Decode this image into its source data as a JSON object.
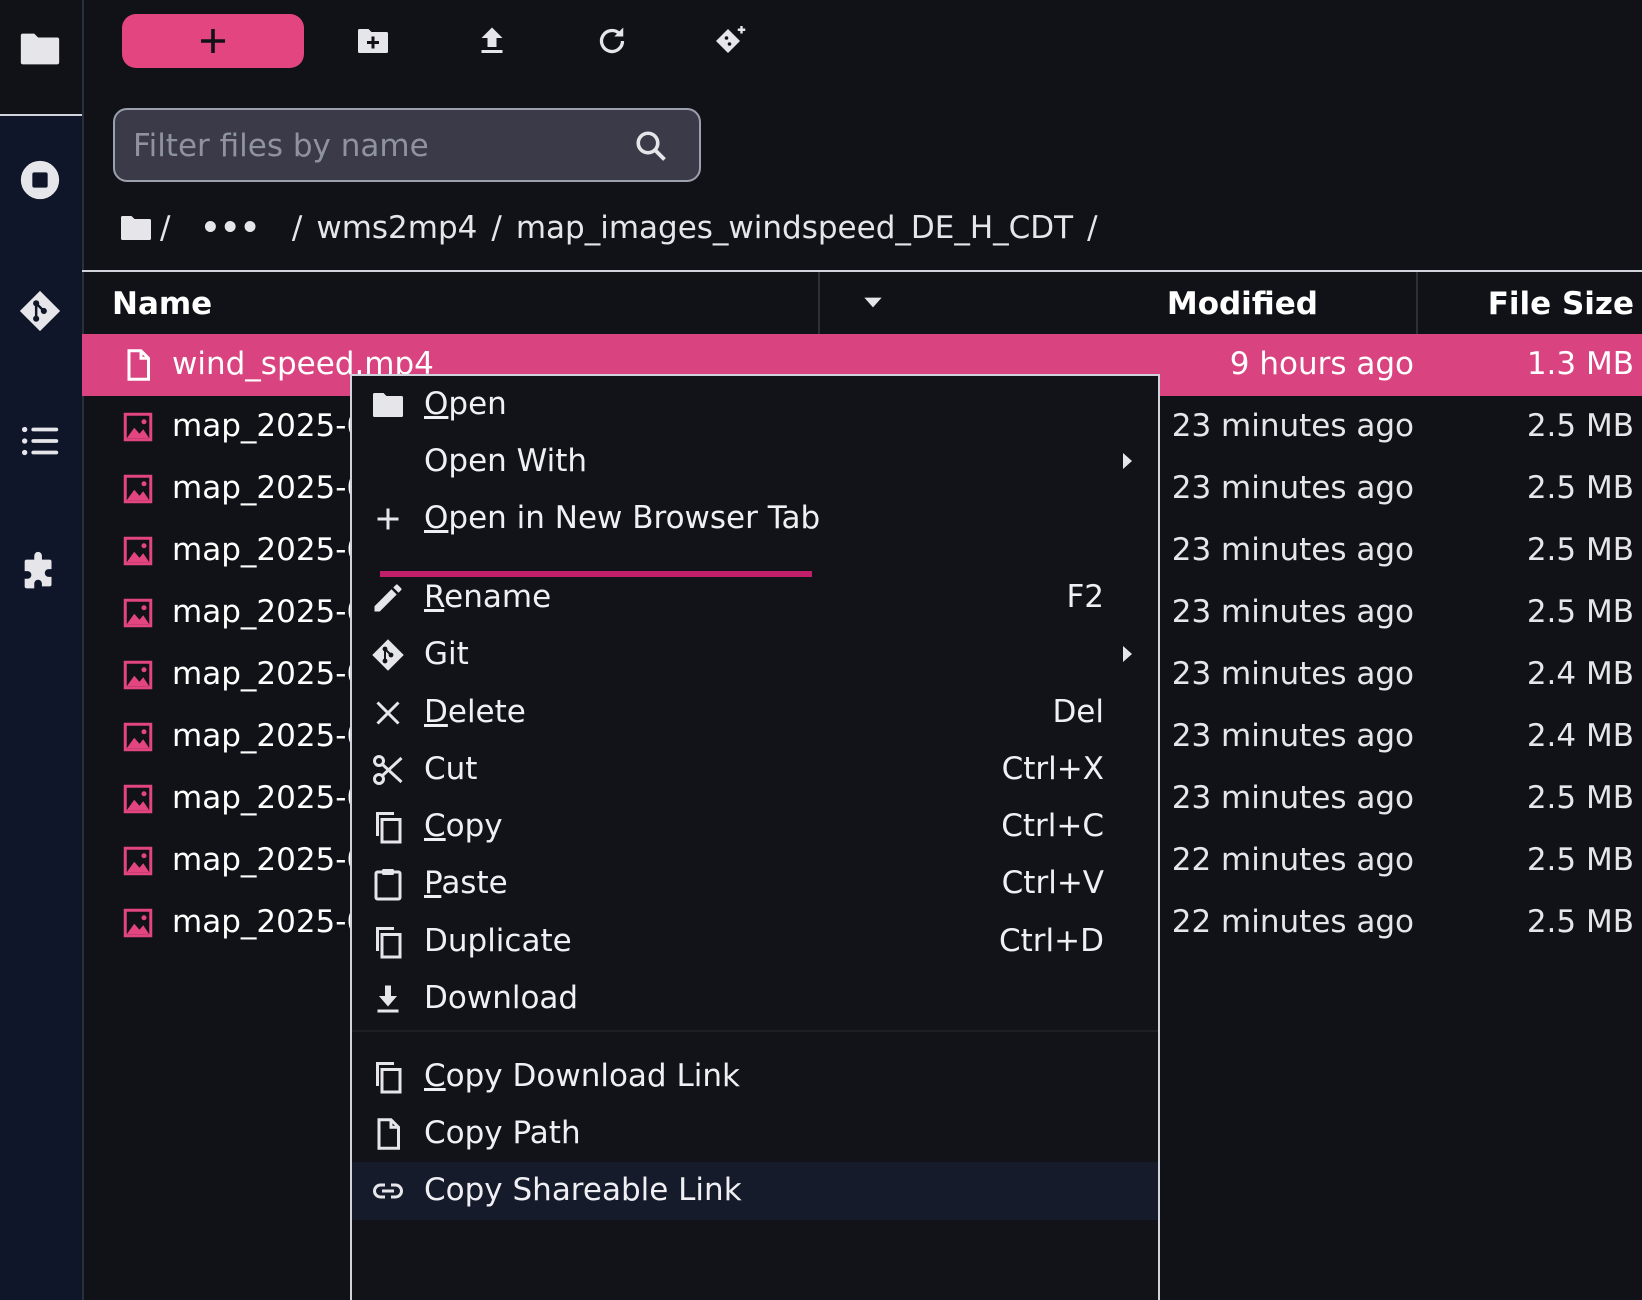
{
  "colors": {
    "accent": "#e2457f",
    "selected_row": "#d9437f",
    "background": "#111217",
    "sidebar": "#0f1629",
    "menu_accent": "#c21f6a"
  },
  "activity_bar": {
    "items": [
      {
        "name": "file-browser",
        "icon": "folder-icon"
      },
      {
        "name": "running-sessions",
        "icon": "stop-circle-icon"
      },
      {
        "name": "git",
        "icon": "git-icon"
      },
      {
        "name": "table-of-contents",
        "icon": "list-icon"
      },
      {
        "name": "extensions",
        "icon": "puzzle-icon"
      }
    ]
  },
  "toolbar": {
    "new_launcher_icon": "plus-icon",
    "new_folder_icon": "new-folder-icon",
    "upload_icon": "upload-icon",
    "refresh_icon": "refresh-icon",
    "git_clone_icon": "git-clone-icon"
  },
  "filter": {
    "placeholder": "Filter files by name",
    "value": ""
  },
  "breadcrumb": {
    "root": "/",
    "ellipsis": "•••",
    "sep": "/",
    "parts": [
      "wms2mp4",
      "map_images_windspeed_DE_H_CDT"
    ],
    "trailing": "/"
  },
  "columns": {
    "name": "Name",
    "modified": "Modified",
    "size": "File Size"
  },
  "files": [
    {
      "name": "wind_speed.mp4",
      "modified": "9 hours ago",
      "size": "1.3 MB",
      "type": "file",
      "selected": true
    },
    {
      "name": "map_2025-0",
      "modified": "23 minutes ago",
      "size": "2.5 MB",
      "type": "image"
    },
    {
      "name": "map_2025-0",
      "modified": "23 minutes ago",
      "size": "2.5 MB",
      "type": "image"
    },
    {
      "name": "map_2025-0",
      "modified": "23 minutes ago",
      "size": "2.5 MB",
      "type": "image"
    },
    {
      "name": "map_2025-0",
      "modified": "23 minutes ago",
      "size": "2.5 MB",
      "type": "image"
    },
    {
      "name": "map_2025-0",
      "modified": "23 minutes ago",
      "size": "2.4 MB",
      "type": "image"
    },
    {
      "name": "map_2025-0",
      "modified": "23 minutes ago",
      "size": "2.4 MB",
      "type": "image"
    },
    {
      "name": "map_2025-0",
      "modified": "23 minutes ago",
      "size": "2.5 MB",
      "type": "image"
    },
    {
      "name": "map_2025-0",
      "modified": "22 minutes ago",
      "size": "2.5 MB",
      "type": "image"
    },
    {
      "name": "map_2025-0",
      "modified": "22 minutes ago",
      "size": "2.5 MB",
      "type": "image"
    }
  ],
  "context_menu": {
    "items": [
      {
        "label": "Open",
        "shortcut": "",
        "icon": "folder-icon"
      },
      {
        "label": "Open With",
        "shortcut": "",
        "icon": "",
        "submenu": true
      },
      {
        "label": "Open in New Browser Tab",
        "shortcut": "",
        "icon": "plus-icon"
      },
      {
        "label": "Rename",
        "shortcut": "F2",
        "icon": "pencil-icon"
      },
      {
        "label": "Git",
        "shortcut": "",
        "icon": "git-icon",
        "submenu": true
      },
      {
        "label": "Delete",
        "shortcut": "Del",
        "icon": "close-icon"
      },
      {
        "label": "Cut",
        "shortcut": "Ctrl+X",
        "icon": "scissors-icon"
      },
      {
        "label": "Copy",
        "shortcut": "Ctrl+C",
        "icon": "copy-icon"
      },
      {
        "label": "Paste",
        "shortcut": "Ctrl+V",
        "icon": "paste-icon"
      },
      {
        "label": "Duplicate",
        "shortcut": "Ctrl+D",
        "icon": "duplicate-icon"
      },
      {
        "label": "Download",
        "shortcut": "",
        "icon": "download-icon"
      },
      {
        "label": "Copy Download Link",
        "shortcut": "",
        "icon": "copy-icon"
      },
      {
        "label": "Copy Path",
        "shortcut": "",
        "icon": "file-icon"
      },
      {
        "label": "Copy Shareable Link",
        "shortcut": "",
        "icon": "link-icon",
        "hovered": true
      }
    ]
  }
}
